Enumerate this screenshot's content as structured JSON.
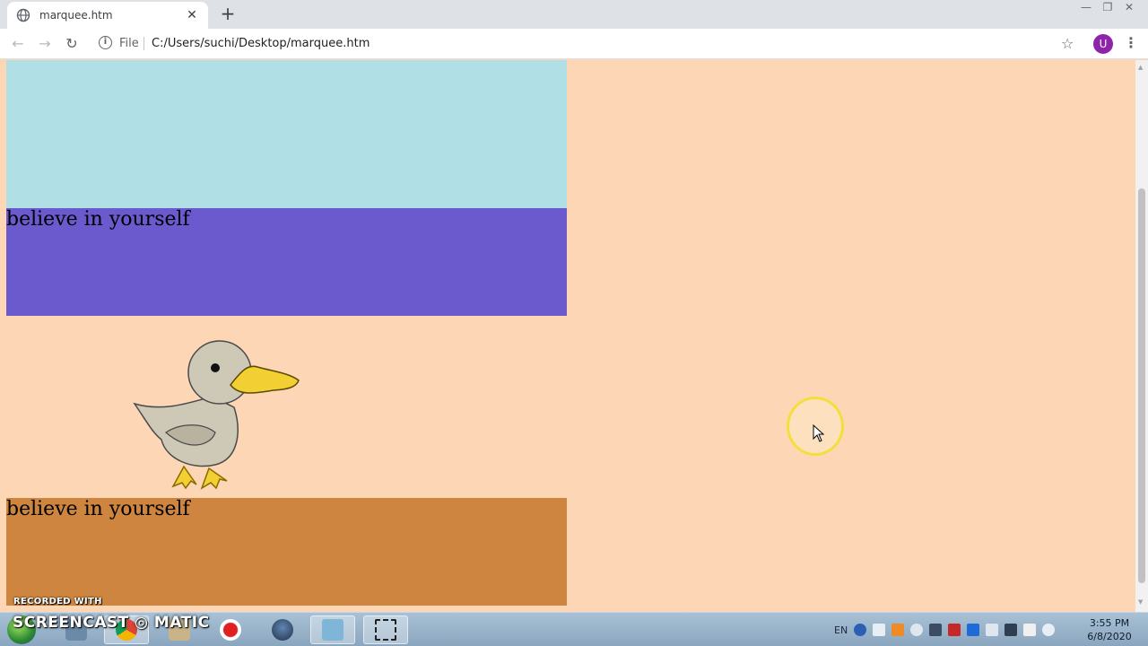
{
  "browser": {
    "tab_title": "marquee.htm",
    "tab_close": "✕",
    "new_tab": "+",
    "file_label": "File",
    "url": "C:/Users/suchi/Desktop/marquee.htm",
    "avatar_letter": "U",
    "window_controls": [
      "—",
      "❐",
      "✕"
    ]
  },
  "page": {
    "background": "#fdd6b5",
    "bands": [
      {
        "color": "#b0dfe5",
        "text": ""
      },
      {
        "color": "#6a5acd",
        "text": "believe in yourself"
      },
      {
        "color": "#cd853f",
        "text": "believe in yourself"
      }
    ]
  },
  "overlay": {
    "recorded_with": "RECORDED WITH",
    "brand": "SCREENCAST ◎ MATIC"
  },
  "taskbar": {
    "lang": "EN",
    "time": "3:55 PM",
    "date": "6/8/2020"
  }
}
